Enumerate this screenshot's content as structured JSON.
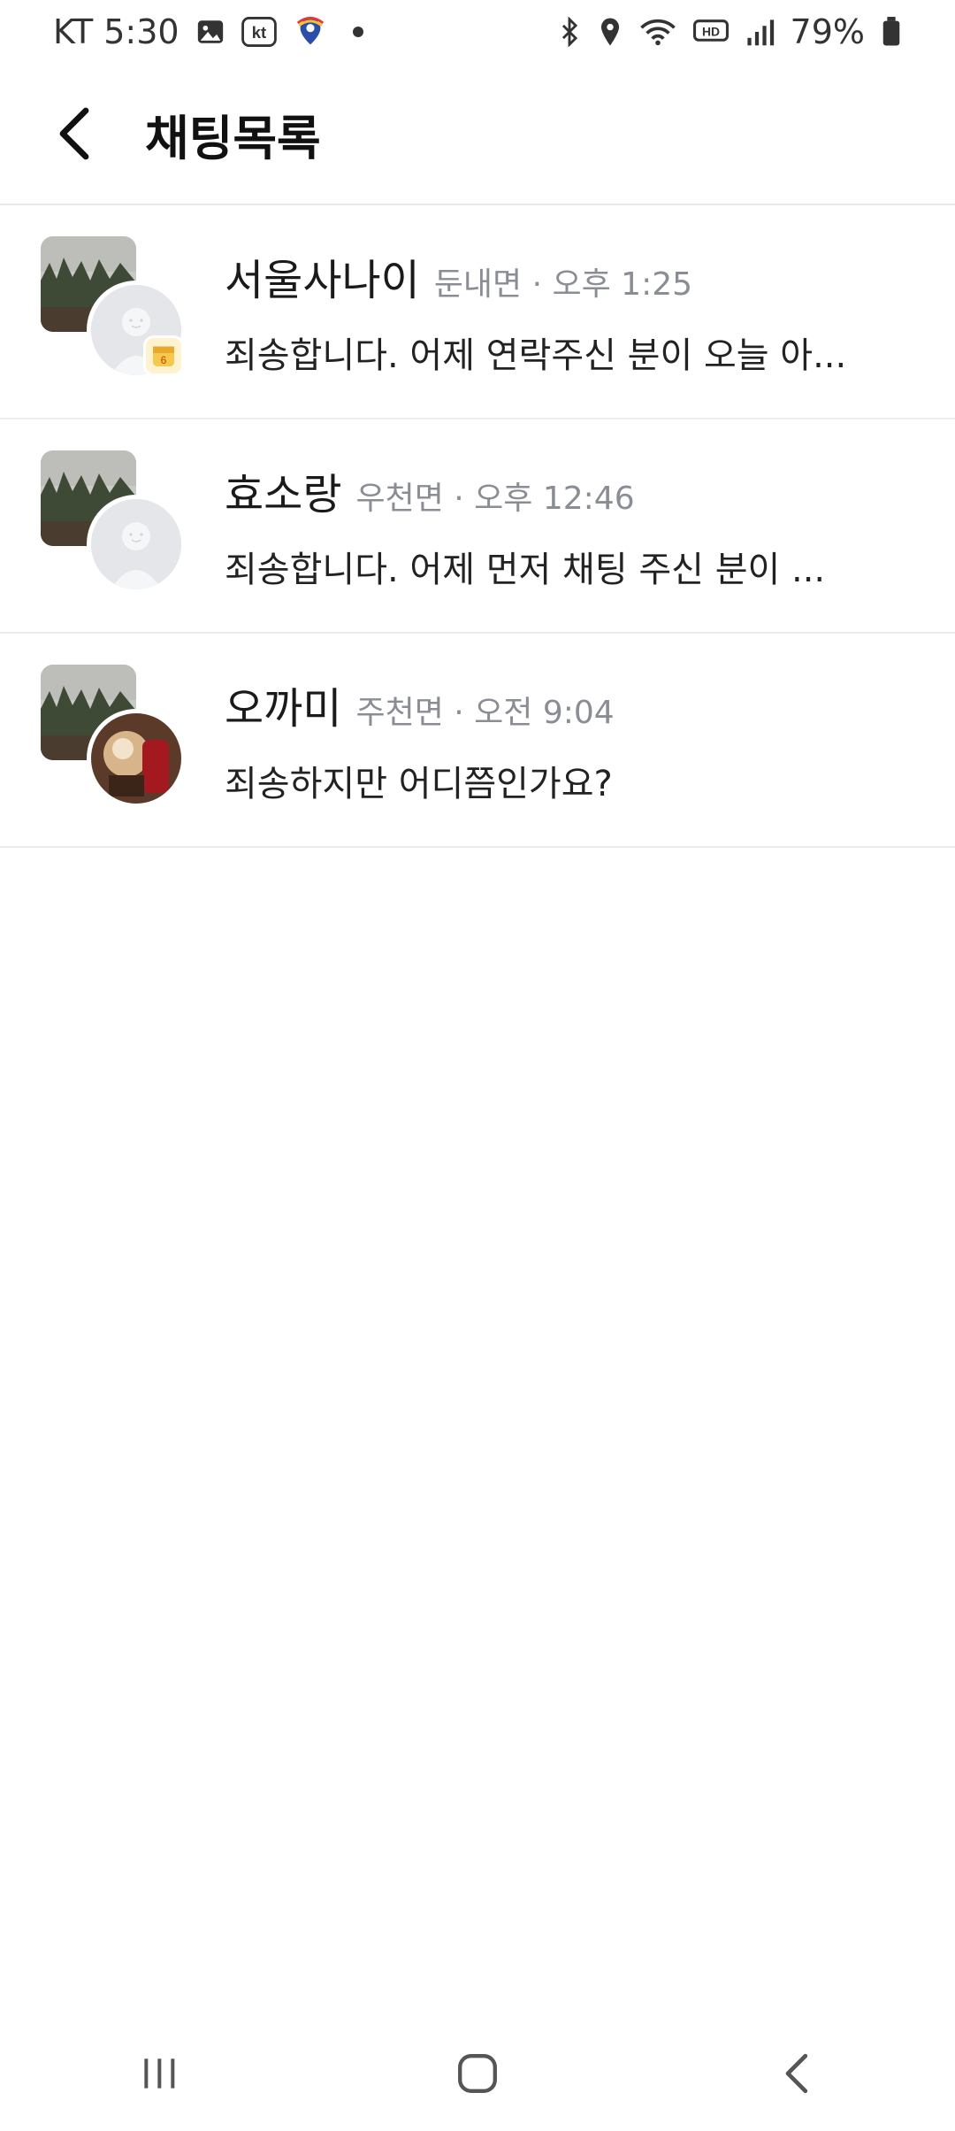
{
  "status_bar": {
    "carrier_time": "KT 5:30",
    "battery_percent": "79%",
    "icons_left": [
      "gallery-icon",
      "kt-icon",
      "map-pin-app-icon",
      "dot"
    ],
    "icons_right": [
      "bluetooth-icon",
      "location-icon",
      "wifi-icon",
      "hd-icon",
      "signal-icon",
      "battery-icon"
    ]
  },
  "header": {
    "title": "채팅목록"
  },
  "chats": [
    {
      "name": "서울사나이",
      "meta": "둔내면 · 오후 1:25",
      "preview": "죄송합니다. 어제 연락주신 분이 오늘 아...",
      "avatar": "default-avatar",
      "has_badge": true
    },
    {
      "name": "효소랑",
      "meta": "우천면 · 오후 12:46",
      "preview": "죄송합니다. 어제 먼저 채팅 주신 분이 ...",
      "avatar": "default-avatar",
      "has_badge": false
    },
    {
      "name": "오까미",
      "meta": "주천면 · 오전 9:04",
      "preview": "죄송하지만 어디쯤인가요?",
      "avatar": "photo-avatar",
      "has_badge": false
    }
  ],
  "colors": {
    "divider": "#ececee",
    "meta_text": "#8a8d93",
    "badge_bg": "#fff3cf"
  }
}
